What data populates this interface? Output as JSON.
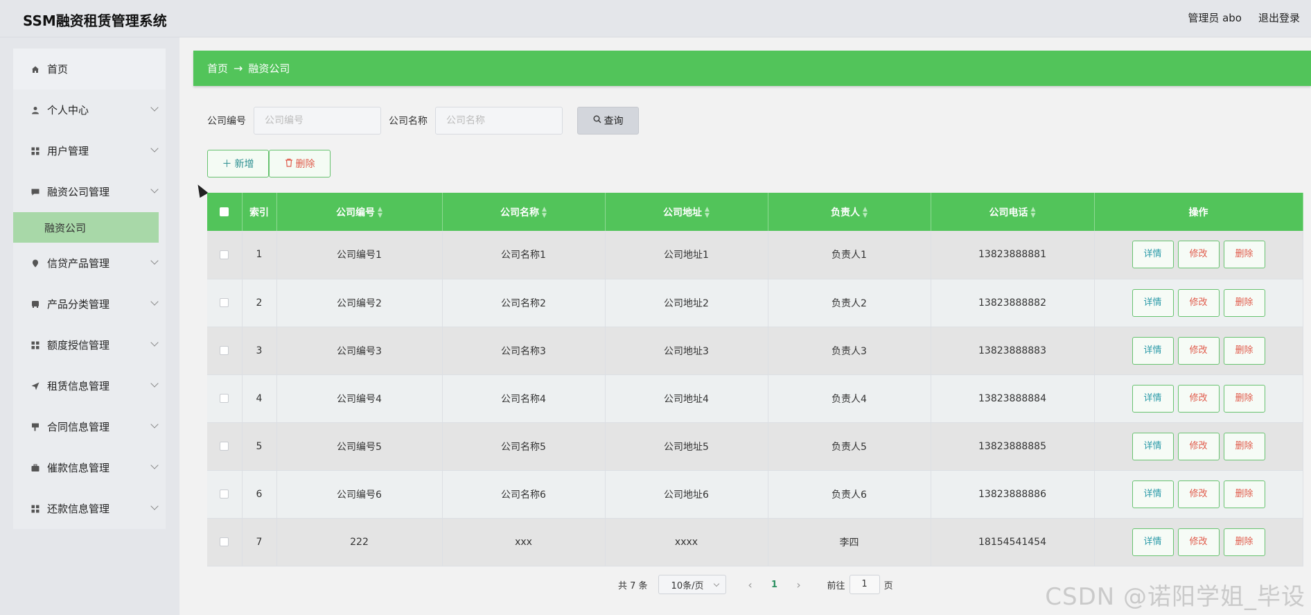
{
  "app": {
    "title": "SSM融资租赁管理系统",
    "user": "管理员 abo",
    "logout": "退出登录"
  },
  "sidebar": {
    "home": "首页",
    "items": [
      {
        "label": "个人中心",
        "icon": "person-icon"
      },
      {
        "label": "用户管理",
        "icon": "grid-icon"
      },
      {
        "label": "融资公司管理",
        "icon": "message-icon"
      }
    ],
    "sub_active": "融资公司",
    "items2": [
      {
        "label": "信贷产品管理",
        "icon": "location-icon"
      },
      {
        "label": "产品分类管理",
        "icon": "bus-icon"
      },
      {
        "label": "额度授信管理",
        "icon": "grid-icon"
      },
      {
        "label": "租赁信息管理",
        "icon": "send-icon"
      },
      {
        "label": "合同信息管理",
        "icon": "flag-icon"
      },
      {
        "label": "催款信息管理",
        "icon": "briefcase-icon"
      },
      {
        "label": "还款信息管理",
        "icon": "grid-icon"
      }
    ]
  },
  "breadcrumb": {
    "home": "首页",
    "current": "融资公司"
  },
  "search": {
    "label1": "公司编号",
    "placeholder1": "公司编号",
    "label2": "公司名称",
    "placeholder2": "公司名称",
    "button": "查询"
  },
  "actions": {
    "add": "新增",
    "delete": "删除"
  },
  "table": {
    "headers": [
      "索引",
      "公司编号",
      "公司名称",
      "公司地址",
      "负责人",
      "公司电话",
      "操作"
    ],
    "op_labels": {
      "detail": "详情",
      "edit": "修改",
      "delete": "删除"
    },
    "rows": [
      [
        "1",
        "公司编号1",
        "公司名称1",
        "公司地址1",
        "负责人1",
        "13823888881"
      ],
      [
        "2",
        "公司编号2",
        "公司名称2",
        "公司地址2",
        "负责人2",
        "13823888882"
      ],
      [
        "3",
        "公司编号3",
        "公司名称3",
        "公司地址3",
        "负责人3",
        "13823888883"
      ],
      [
        "4",
        "公司编号4",
        "公司名称4",
        "公司地址4",
        "负责人4",
        "13823888884"
      ],
      [
        "5",
        "公司编号5",
        "公司名称5",
        "公司地址5",
        "负责人5",
        "13823888885"
      ],
      [
        "6",
        "公司编号6",
        "公司名称6",
        "公司地址6",
        "负责人6",
        "13823888886"
      ],
      [
        "7",
        "222",
        "xxx",
        "xxxx",
        "李四",
        "18154541454"
      ]
    ]
  },
  "pager": {
    "total": "共 7 条",
    "size": "10条/页",
    "page": "1",
    "goto": "前往",
    "goto_value": "1",
    "goto_suffix": "页"
  },
  "watermark": "CSDN @诺阳学姐_毕设",
  "colors": {
    "accent": "#52c45a",
    "sub_active": "#a8d8a8",
    "delete": "#e05a4a"
  }
}
